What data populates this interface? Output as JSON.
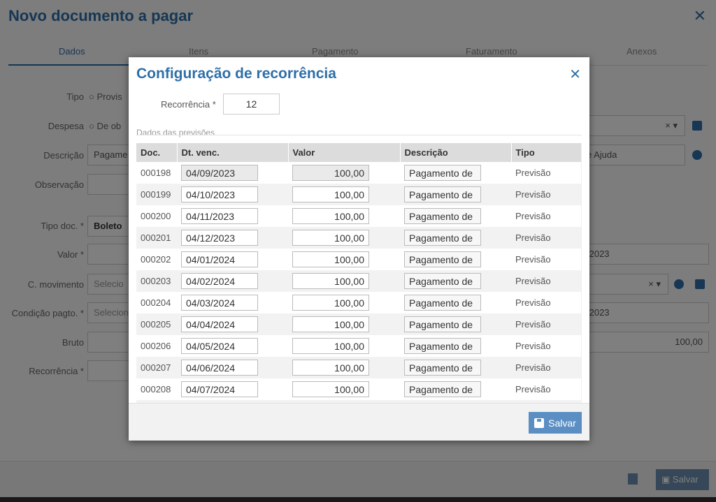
{
  "background": {
    "title": "Novo documento a pagar",
    "tabs": [
      "Dados",
      "Itens",
      "Pagamento",
      "Faturamento",
      "Anexos"
    ],
    "fields": {
      "tipo_label": "Tipo",
      "tipo_option": "Provis",
      "despesa_label": "Despesa",
      "despesa_option": "De ob",
      "descricao_label": "Descrição",
      "descricao_value": "Pagame",
      "descricao_right": "e Ajuda",
      "observacao_label": "Observação",
      "tipo_doc_label": "Tipo doc. *",
      "tipo_doc_value": "Boleto",
      "valor_label": "Valor *",
      "valor_right": "/2023",
      "c_movimento_label": "C. movimento",
      "c_movimento_value": "Selecio",
      "condicao_label": "Condição pagto. *",
      "condicao_value": "Selecion",
      "condicao_right": "/2023",
      "bruto_label": "Bruto",
      "bruto_right": "100,00",
      "recorrencia_label": "Recorrência *"
    },
    "save_label": "Salvar"
  },
  "modal": {
    "title": "Configuração de recorrência",
    "recorrencia_label": "Recorrência *",
    "recorrencia_value": "12",
    "section_title": "Dados das previsões",
    "columns": [
      "Doc.",
      "Dt. venc.",
      "Valor",
      "Descrição",
      "Tipo"
    ],
    "rows": [
      {
        "doc": "000198",
        "venc": "04/09/2023",
        "valor": "100,00",
        "desc": "Pagamento de",
        "tipo": "Previsão"
      },
      {
        "doc": "000199",
        "venc": "04/10/2023",
        "valor": "100,00",
        "desc": "Pagamento de",
        "tipo": "Previsão"
      },
      {
        "doc": "000200",
        "venc": "04/11/2023",
        "valor": "100,00",
        "desc": "Pagamento de",
        "tipo": "Previsão"
      },
      {
        "doc": "000201",
        "venc": "04/12/2023",
        "valor": "100,00",
        "desc": "Pagamento de",
        "tipo": "Previsão"
      },
      {
        "doc": "000202",
        "venc": "04/01/2024",
        "valor": "100,00",
        "desc": "Pagamento de",
        "tipo": "Previsão"
      },
      {
        "doc": "000203",
        "venc": "04/02/2024",
        "valor": "100,00",
        "desc": "Pagamento de",
        "tipo": "Previsão"
      },
      {
        "doc": "000204",
        "venc": "04/03/2024",
        "valor": "100,00",
        "desc": "Pagamento de",
        "tipo": "Previsão"
      },
      {
        "doc": "000205",
        "venc": "04/04/2024",
        "valor": "100,00",
        "desc": "Pagamento de",
        "tipo": "Previsão"
      },
      {
        "doc": "000206",
        "venc": "04/05/2024",
        "valor": "100,00",
        "desc": "Pagamento de",
        "tipo": "Previsão"
      },
      {
        "doc": "000207",
        "venc": "04/06/2024",
        "valor": "100,00",
        "desc": "Pagamento de",
        "tipo": "Previsão"
      },
      {
        "doc": "000208",
        "venc": "04/07/2024",
        "valor": "100,00",
        "desc": "Pagamento de",
        "tipo": "Previsão"
      },
      {
        "doc": "",
        "venc": "",
        "valor": "",
        "desc": "",
        "tipo": ""
      }
    ],
    "save_label": "Salvar"
  }
}
